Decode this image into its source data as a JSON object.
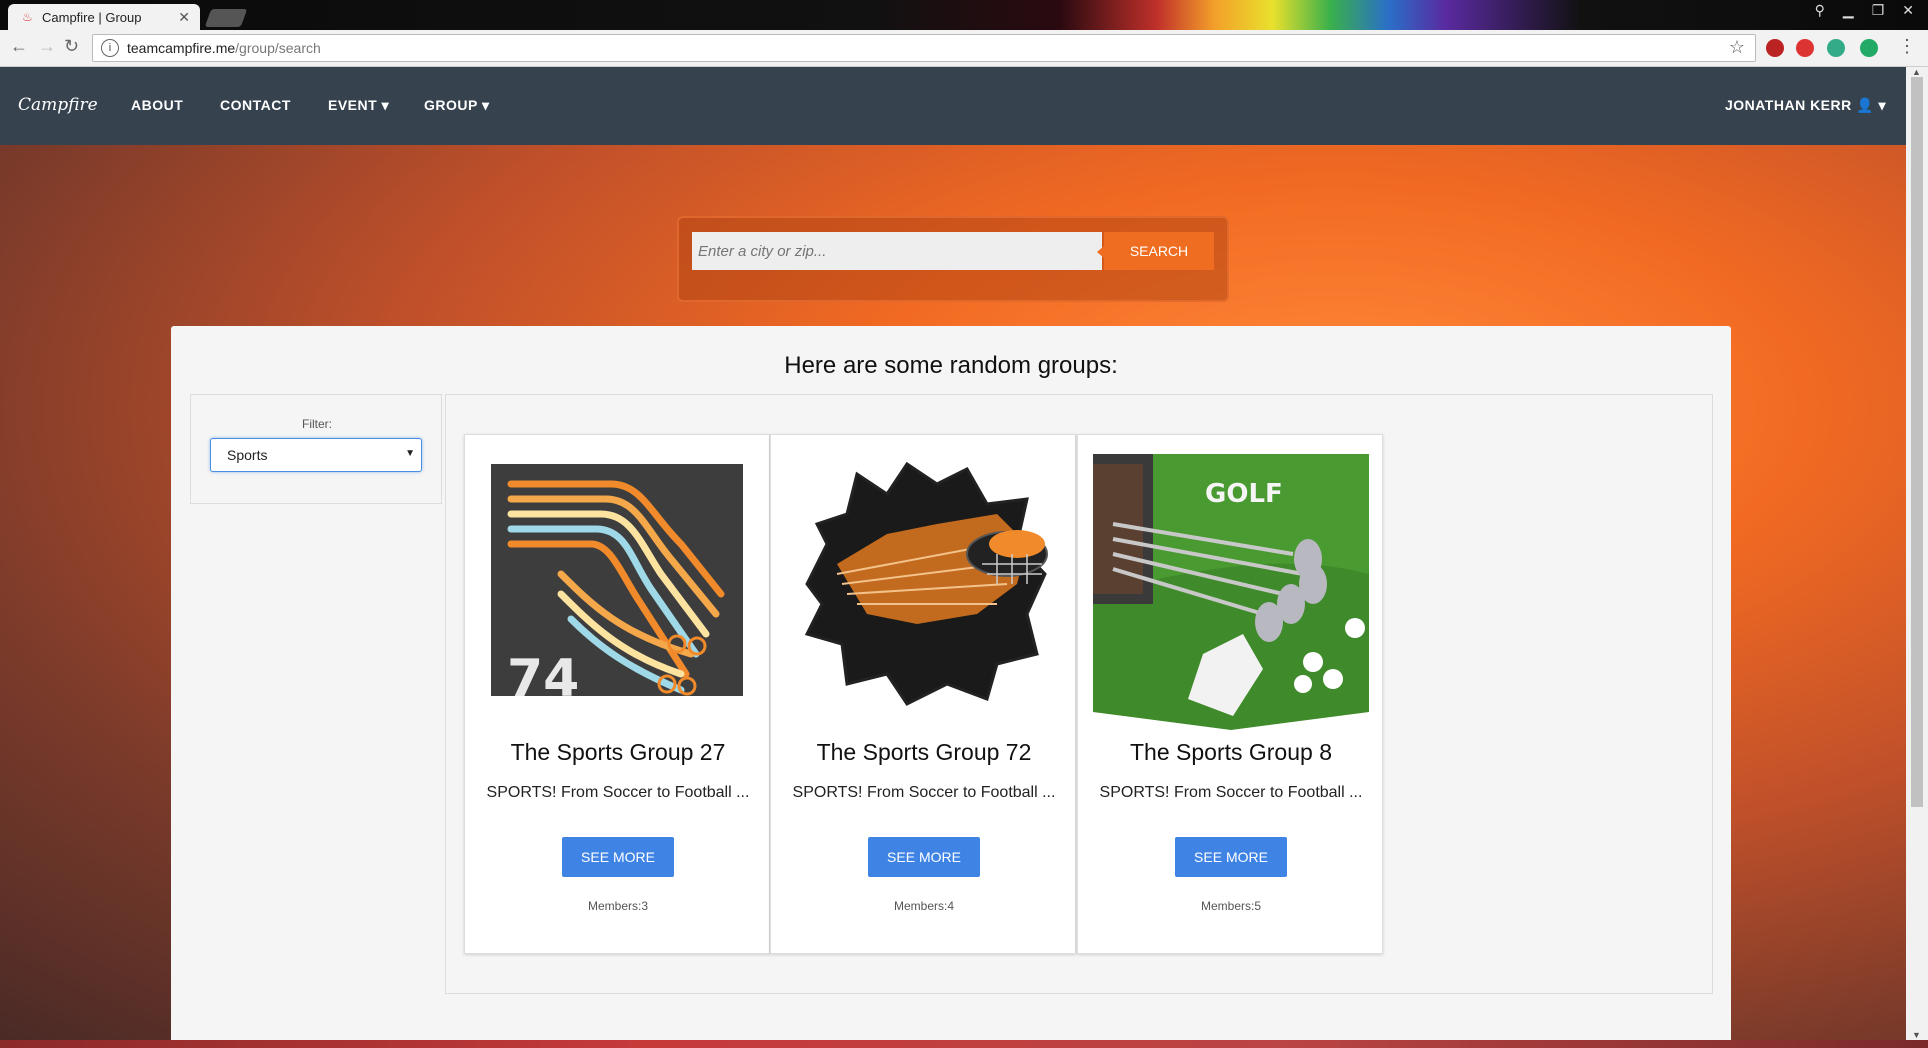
{
  "browser": {
    "tab_title": "Campfire | Group",
    "url_host": "teamcampfire.me",
    "url_path": "/group/search"
  },
  "nav": {
    "brand": "Campfire",
    "links": [
      "ABOUT",
      "CONTACT",
      "EVENT",
      "GROUP"
    ],
    "user": "JONATHAN KERR"
  },
  "search": {
    "placeholder": "Enter a city or zip...",
    "button": "SEARCH"
  },
  "main": {
    "heading": "Here are some random groups:",
    "filter_label": "Filter:",
    "filter_value": "Sports"
  },
  "groups": [
    {
      "title": "The Sports Group 27",
      "desc": "SPORTS! From Soccer to Football ...",
      "button": "SEE MORE",
      "members": "Members:3",
      "image_text": "74"
    },
    {
      "title": "The Sports Group 72",
      "desc": "SPORTS! From Soccer to Football ...",
      "button": "SEE MORE",
      "members": "Members:4"
    },
    {
      "title": "The Sports Group 8",
      "desc": "SPORTS! From Soccer to Football ...",
      "button": "SEE MORE",
      "members": "Members:5",
      "image_text": "GOLF"
    }
  ],
  "colors": {
    "nav": "#36434f",
    "accent": "#ef6d20",
    "button": "#3f84e5"
  }
}
